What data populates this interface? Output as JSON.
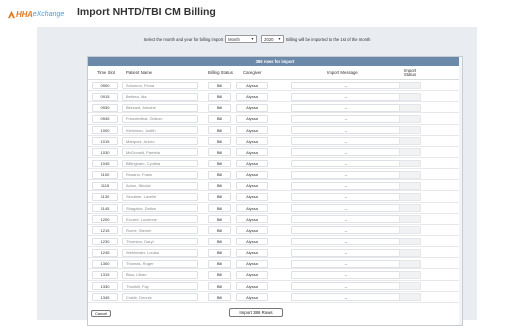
{
  "header": {
    "logo_hha": "HHA",
    "logo_ex": "eXchange",
    "title": "Import NHTD/TBI CM Billing"
  },
  "filter": {
    "text_before": "Select the month and year for billing import",
    "month_value": "Month",
    "year_value": "2020",
    "text_after": "Billing will be imported to the 1st of the month"
  },
  "table": {
    "banner": "386 rows for import",
    "columns": {
      "time_slot": "Time Slot",
      "patient_name": "Patient Name",
      "billing_status": "Billing Status",
      "caregiver": "Caregiver",
      "import_message": "Import Message",
      "import_status": "Import Status"
    },
    "rows": [
      {
        "time": "0900",
        "name": "Solomon, Fiona",
        "status": "Bill",
        "caregiver": "Alyssa",
        "message": "--"
      },
      {
        "time": "0915",
        "name": "Bethea, Ida",
        "status": "Bill",
        "caregiver": "Alyssa",
        "message": "--"
      },
      {
        "time": "0930",
        "name": "Blizzard, Antoine",
        "status": "Bill",
        "caregiver": "Alyssa",
        "message": "--"
      },
      {
        "time": "0945",
        "name": "Freudenthal, Gideon",
        "status": "Bill",
        "caregiver": "Alyssa",
        "message": "--"
      },
      {
        "time": "1000",
        "name": "Kleinman, Judith",
        "status": "Bill",
        "caregiver": "Alyssa",
        "message": "--"
      },
      {
        "time": "1015",
        "name": "Marquez, Arturo",
        "status": "Bill",
        "caregiver": "Alyssa",
        "message": "--"
      },
      {
        "time": "1030",
        "name": "McDonald, Pamela",
        "status": "Bill",
        "caregiver": "Alyssa",
        "message": "--"
      },
      {
        "time": "1045",
        "name": "Billingham, Cynthia",
        "status": "Bill",
        "caregiver": "Alyssa",
        "message": "--"
      },
      {
        "time": "1100",
        "name": "Rosano, Frank",
        "status": "Bill",
        "caregiver": "Alyssa",
        "message": "--"
      },
      {
        "time": "1115",
        "name": "Acton, Nikolai",
        "status": "Bill",
        "caregiver": "Alyssa",
        "message": "--"
      },
      {
        "time": "1130",
        "name": "Sinclaire, Lavelle",
        "status": "Bill",
        "caregiver": "Alyssa",
        "message": "--"
      },
      {
        "time": "1145",
        "name": "Shagalov, Dalton",
        "status": "Bill",
        "caregiver": "Alyssa",
        "message": "--"
      },
      {
        "time": "1200",
        "name": "Eccard, Lucienne",
        "status": "Bill",
        "caregiver": "Alyssa",
        "message": "--"
      },
      {
        "time": "1215",
        "name": "Rome, Steven",
        "status": "Bill",
        "caregiver": "Alyssa",
        "message": "--"
      },
      {
        "time": "1230",
        "name": "Thornton, Daryl",
        "status": "Bill",
        "caregiver": "Alyssa",
        "message": "--"
      },
      {
        "time": "1245",
        "name": "Wehlmaier, Louisa",
        "status": "Bill",
        "caregiver": "Alyssa",
        "message": "--"
      },
      {
        "time": "1300",
        "name": "Thomas, Roger",
        "status": "Bill",
        "caregiver": "Alyssa",
        "message": "--"
      },
      {
        "time": "1315",
        "name": "Blau, Lillian",
        "status": "Bill",
        "caregiver": "Alyssa",
        "message": "--"
      },
      {
        "time": "1330",
        "name": "Thurlkill, Fay",
        "status": "Bill",
        "caregiver": "Alyssa",
        "message": "--"
      },
      {
        "time": "1345",
        "name": "Crabb, Dennis",
        "status": "Bill",
        "caregiver": "Alyssa",
        "message": "--"
      }
    ]
  },
  "footer": {
    "cancel_label": "Cancel",
    "import_label": "Import 386 Rows"
  },
  "colors": {
    "brand_orange": "#e07a22",
    "brand_blue": "#4a9ad4",
    "banner_bg": "#6b89a8",
    "panel_bg": "#e9ecf1"
  }
}
